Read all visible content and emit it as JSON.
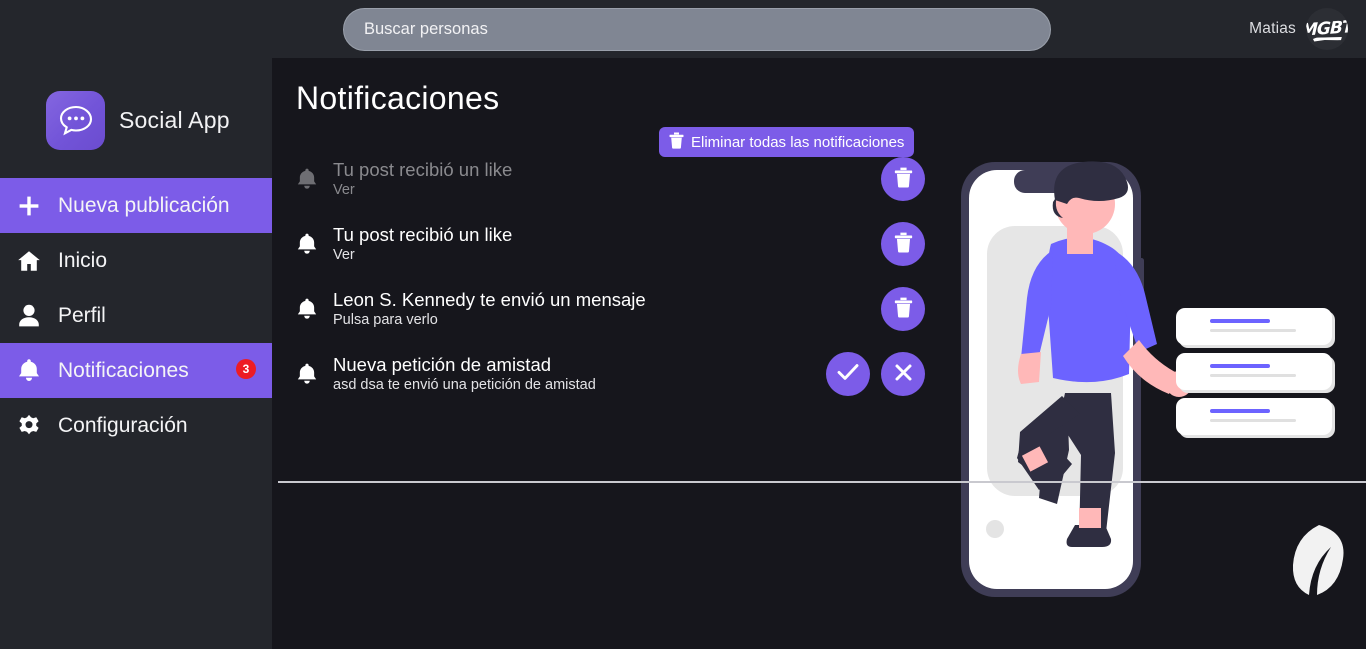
{
  "header": {
    "search": {
      "placeholder": "Buscar personas",
      "value": ""
    },
    "user": {
      "name": "Matias",
      "avatar_text": "MGBT",
      "avatar_icon": "avatar-image"
    }
  },
  "brand": {
    "name": "Social App",
    "logo_icon": "chat-bubble-icon"
  },
  "sidebar": {
    "items": [
      {
        "label": "Nueva publicación",
        "icon": "plus-icon",
        "active": true,
        "badge": ""
      },
      {
        "label": "Inicio",
        "icon": "home-icon",
        "active": false,
        "badge": ""
      },
      {
        "label": "Perfil",
        "icon": "person-icon",
        "active": false,
        "badge": ""
      },
      {
        "label": "Notificaciones",
        "icon": "bell-icon",
        "active": true,
        "badge": "3"
      },
      {
        "label": "Configuración",
        "icon": "gear-icon",
        "active": false,
        "badge": ""
      }
    ]
  },
  "main": {
    "title": "Notificaciones",
    "clear_all_label": "Eliminar todas las notificaciones",
    "clear_all_icon": "trash-icon",
    "notifications": [
      {
        "title": "Tu post recibió un like",
        "subtitle": "Ver",
        "icon": "bell-icon",
        "read": true,
        "actions": [
          {
            "type": "delete",
            "icon": "trash-icon"
          }
        ]
      },
      {
        "title": "Tu post recibió un like",
        "subtitle": "Ver",
        "icon": "bell-icon",
        "read": false,
        "actions": [
          {
            "type": "delete",
            "icon": "trash-icon"
          }
        ]
      },
      {
        "title": "Leon S. Kennedy te envió un mensaje",
        "subtitle": "Pulsa para verlo",
        "icon": "bell-icon",
        "read": false,
        "actions": [
          {
            "type": "delete",
            "icon": "trash-icon"
          }
        ]
      },
      {
        "title": "Nueva petición de amistad",
        "subtitle": "asd dsa te envió una petición de amistad",
        "icon": "bell-icon",
        "read": false,
        "actions": [
          {
            "type": "accept",
            "icon": "check-icon"
          },
          {
            "type": "reject",
            "icon": "close-icon"
          }
        ]
      }
    ],
    "illustration_name": "person-with-phone-illustration"
  },
  "colors": {
    "accent": "#7c5ce8",
    "badge": "#ed1c24",
    "sidebar_bg": "#24262c",
    "content_bg": "#16161c",
    "search_bg": "#808693",
    "illustration_purple": "#6c63ff"
  }
}
